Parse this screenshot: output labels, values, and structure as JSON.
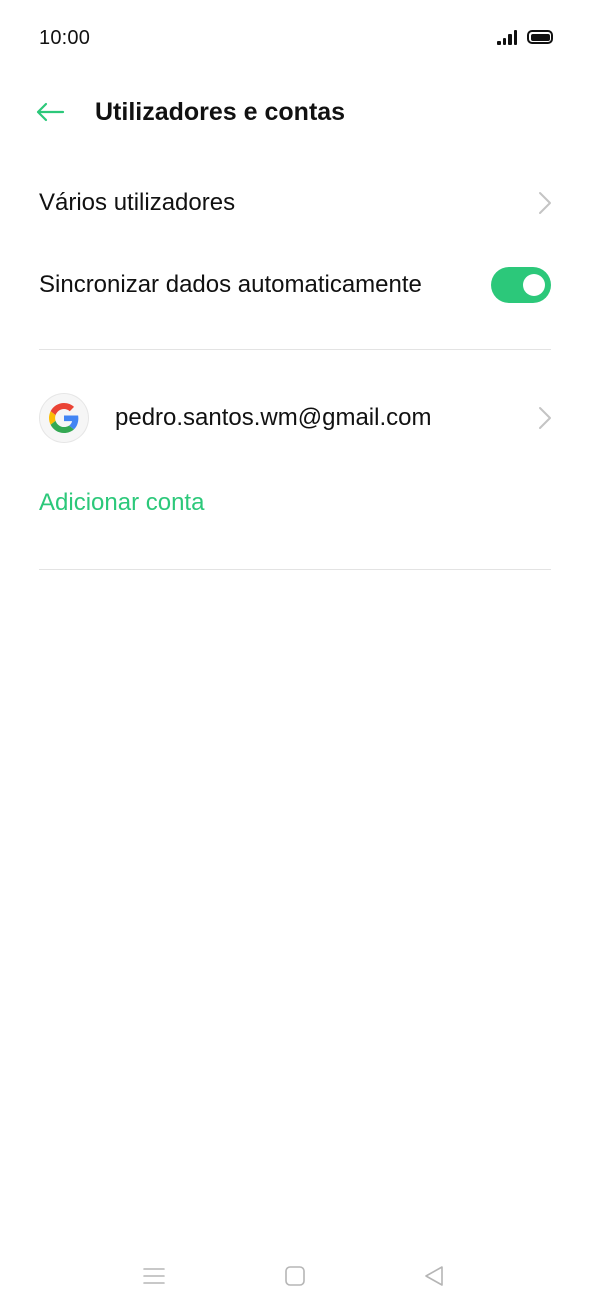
{
  "status_bar": {
    "time": "10:00"
  },
  "header": {
    "title": "Utilizadores e contas"
  },
  "settings": {
    "multiple_users_label": "Vários utilizadores",
    "auto_sync_label": "Sincronizar dados automaticamente",
    "auto_sync_enabled": true
  },
  "accounts": {
    "items": [
      {
        "email": "pedro.santos.wm@gmail.com",
        "icon": "google-icon"
      }
    ],
    "add_account_label": "Adicionar conta"
  },
  "colors": {
    "accent": "#2cc87a",
    "text": "#111111",
    "divider": "#e3e3e3"
  }
}
